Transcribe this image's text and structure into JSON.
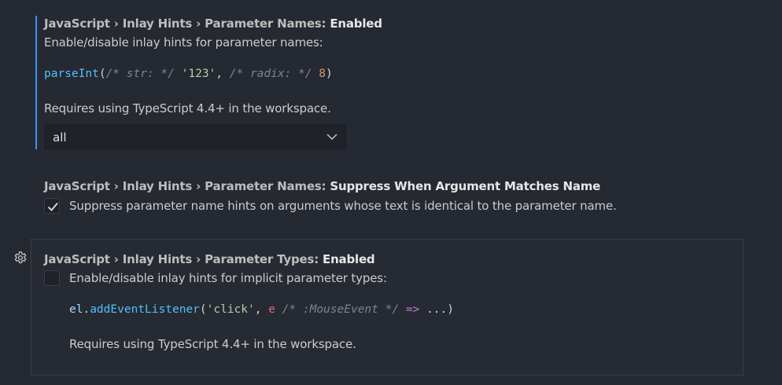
{
  "settings": [
    {
      "title_prefix": "JavaScript › Inlay Hints › Parameter Names: ",
      "title_name": "Enabled",
      "description": "Enable/disable inlay hints for parameter names:",
      "code": {
        "fn": "parseInt",
        "open": "(",
        "c1": "/* str: */",
        "s1": " ",
        "arg1": "'123'",
        "comma": ", ",
        "c2": "/* radix: */",
        "s2": " ",
        "arg2": "8",
        "close": ")"
      },
      "note": "Requires using TypeScript 4.4+ in the workspace.",
      "select_value": "all"
    },
    {
      "title_prefix": "JavaScript › Inlay Hints › Parameter Names: ",
      "title_name": "Suppress When Argument Matches Name",
      "description": "Suppress parameter name hints on arguments whose text is identical to the parameter name.",
      "checked": true
    },
    {
      "title_prefix": "JavaScript › Inlay Hints › Parameter Types: ",
      "title_name": "Enabled",
      "description": "Enable/disable inlay hints for implicit parameter types:",
      "code": {
        "obj": "el",
        "dot": ".",
        "fn": "addEventListener",
        "open": "(",
        "arg1": "'click'",
        "comma": ", ",
        "param": "e",
        "s1": " ",
        "cmt": "/* :MouseEvent */",
        "s2": " ",
        "arrow": "=>",
        "rest": " ...)"
      },
      "note": "Requires using TypeScript 4.4+ in the workspace.",
      "checked": false
    }
  ],
  "colors": {
    "background": "#252931",
    "focus_border": "#3794ff",
    "title_text": "#e7e7e7",
    "description_text": "#cccccc"
  },
  "icons": {
    "select_chevron": "chevron-down-icon",
    "checkbox_check": "check-icon",
    "setting_menu": "gear-icon"
  }
}
